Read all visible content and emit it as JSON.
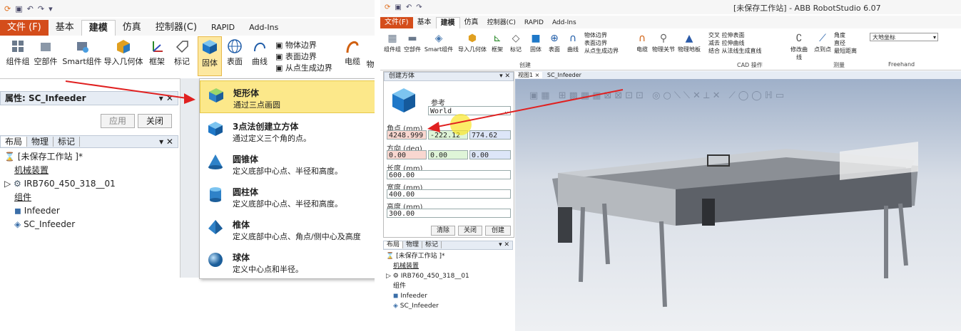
{
  "left": {
    "tabs": [
      {
        "label": "文件 (F)",
        "kind": "file"
      },
      {
        "label": "基本"
      },
      {
        "label": "建模",
        "active": true
      },
      {
        "label": "仿真"
      },
      {
        "label": "控制器(C)"
      },
      {
        "label": "RAPID"
      },
      {
        "label": "Add-Ins"
      }
    ],
    "ribbon": [
      "组件组",
      "空部件",
      "Smart组件",
      "导入几何体",
      "框架",
      "标记",
      "固体",
      "表面",
      "曲线",
      "电缆"
    ],
    "border_options": [
      "物体边界",
      "表面边界",
      "从点生成边界"
    ],
    "ribbon_cut": "物",
    "props_title": "属性: SC_Infeeder",
    "apply": "应用",
    "close": "关闭",
    "panel_tabs": [
      "布局",
      "物理",
      "标记"
    ],
    "tree": [
      "[未保存工作站 ]*",
      "机械装置",
      "IRB760_450_318__01",
      "组件",
      "Infeeder",
      "SC_Infeeder"
    ],
    "menu": [
      {
        "title": "矩形体",
        "desc": "通过三点画圆"
      },
      {
        "title": "3点法创建立方体",
        "desc": "通过定义三个角的点。"
      },
      {
        "title": "圆锥体",
        "desc": "定义底部中心点、半径和高度。"
      },
      {
        "title": "圆柱体",
        "desc": "定义底部中心点、半径和高度。"
      },
      {
        "title": "椎体",
        "desc": "定义底部中心点、角点/侧中心及高度"
      },
      {
        "title": "球体",
        "desc": "定义中心点和半径。"
      }
    ]
  },
  "right": {
    "window_title": "[未保存工作站] - ABB RobotStudio 6.07",
    "tabs": [
      "文件(F)",
      "基本",
      "建模",
      "仿真",
      "控制器(C)",
      "RAPID",
      "Add-Ins"
    ],
    "ribbon": [
      "组件组",
      "空部件",
      "Smart组件",
      "导入几何体",
      "框架",
      "标记",
      "固体",
      "表面",
      "曲线",
      "电缆",
      "物理关节",
      "物理地板",
      "修改曲线",
      "点到点"
    ],
    "ribbon_small": [
      "物体边界",
      "表面边界",
      "从点生成边界",
      "交叉",
      "拉伸表面",
      "减去",
      "拉伸曲线",
      "结合",
      "从法线生成直线",
      "角度",
      "直径",
      "最短距离"
    ],
    "groups": [
      "创建",
      "CAD 操作",
      "测量",
      "Freehand"
    ],
    "coord_select": "大地坐标",
    "create_box": {
      "title": "创建方体",
      "ref_label": "参考",
      "ref_value": "World",
      "corner_label": "角点 (mm)",
      "corner": [
        "4248.999",
        "-222.12",
        "774.62"
      ],
      "orient_label": "方向 (deg)",
      "orient": [
        "0.00",
        "0.00",
        "0.00"
      ],
      "length_label": "长度 (mm)",
      "length": "600.00",
      "width_label": "宽度 (mm)",
      "width": "400.00",
      "height_label": "高度 (mm)",
      "height": "300.00",
      "buttons": [
        "清除",
        "关闭",
        "创建"
      ]
    },
    "view_tabs": [
      "视图1",
      "SC_Infeeder"
    ],
    "panel_tabs": [
      "布局",
      "物理",
      "标记"
    ],
    "tree": [
      "[未保存工作站 ]*",
      "机械装置",
      "IRB760_450_318__01",
      "组件",
      "Infeeder",
      "SC_Infeeder"
    ]
  }
}
